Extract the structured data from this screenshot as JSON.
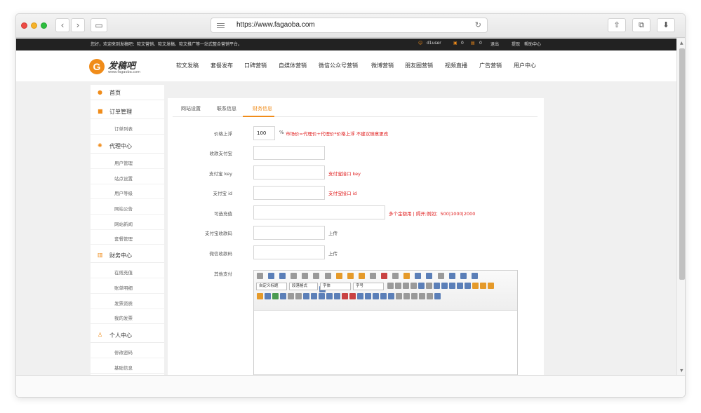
{
  "browser": {
    "url": "https://www.fagaoba.com"
  },
  "topbar": {
    "greeting": "您好，欢迎来到发稿吧：软文营销、软文发稿、软文推广等一站式整合营销平台。",
    "username": "d1user",
    "count_a": "0",
    "count_b": "0",
    "logout": "退出",
    "withdraw": "提现",
    "help": "帮助中心"
  },
  "header": {
    "logo_letter": "G",
    "logo_name": "发稿吧",
    "logo_domain": "www.fagaoba.com",
    "nav": [
      "软文发稿",
      "套餐发布",
      "口碑营销",
      "自媒体营销",
      "微信公众号营销",
      "微博营销",
      "朋友圈营销",
      "视频直播",
      "广告营销",
      "用户中心"
    ]
  },
  "sidebar": {
    "home": "首页",
    "orders": {
      "label": "订单管理",
      "items": [
        "订单列表"
      ]
    },
    "agency": {
      "label": "代理中心",
      "items": [
        "用户管理",
        "站点设置",
        "用户等级",
        "网站公告",
        "网站新闻",
        "套餐管理"
      ]
    },
    "finance": {
      "label": "财务中心",
      "items": [
        "在线充值",
        "账单明细",
        "发票资质",
        "我的发票"
      ]
    },
    "personal": {
      "label": "个人中心",
      "items": [
        "修改密码",
        "基础信息"
      ]
    }
  },
  "tabs": [
    "网站设置",
    "联系信息",
    "财务信息"
  ],
  "form": {
    "price_label": "价格上浮",
    "price_value": "100",
    "price_unit": "%",
    "price_hint": "市场价=代理价+代理价*价格上浮 不建议随意更改",
    "alipay_account_label": "收款支付宝",
    "alipay_key_label": "支付宝 key",
    "alipay_key_hint": "支付宝接口 key",
    "alipay_id_label": "支付宝 id",
    "alipay_id_hint": "支付宝接口 id",
    "recharge_label": "可选充值",
    "recharge_hint": "多个金额用 | 隔开;例如：500|1000|2000",
    "alipay_qr_label": "支付宝收款码",
    "alipay_qr_action": "上传",
    "wechat_qr_label": "微信收款码",
    "wechat_qr_action": "上传",
    "other_pay_label": "其他支付"
  },
  "editor": {
    "select_title": "自定义标题",
    "select_para": "段落格式",
    "select_font": "字体",
    "select_size": "字号"
  },
  "colors": {
    "accent": "#f08c1a",
    "hint_red": "#e02020",
    "top_strip": "#222222"
  }
}
